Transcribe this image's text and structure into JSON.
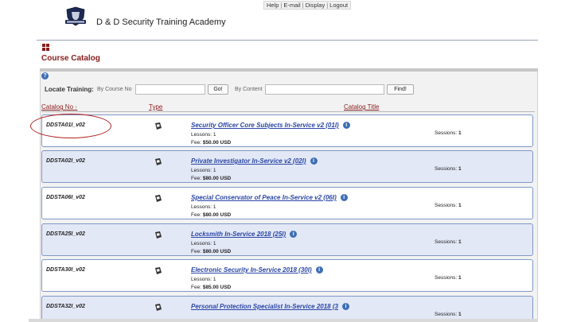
{
  "top_links": [
    "Help",
    "E-mail",
    "Display",
    "Logout"
  ],
  "org_name": "D & D Security Training Academy",
  "page_title": "Course Catalog",
  "locate": {
    "label": "Locate Training:",
    "by_course_no": "By Course No",
    "go_label": "Go!",
    "by_content": "By Content",
    "find_label": "Find!"
  },
  "columns": {
    "catalog_no": "Catalog No",
    "type": "Type",
    "catalog_title": "Catalog Title"
  },
  "sort_indicator": "↑",
  "courses": [
    {
      "catalog_no": "DDSTA01I_v02",
      "title": "Security Officer Core Subjects In-Service v2 (01I)",
      "lessons": "Lessons: 1",
      "fee_label": "Fee:",
      "fee": "$50.00 USD",
      "sessions_label": "Sessions:",
      "sessions": "1"
    },
    {
      "catalog_no": "DDSTA02I_v02",
      "title": "Private Investigator In-Service v2 (02I)",
      "lessons": "Lessons: 1",
      "fee_label": "Fee:",
      "fee": "$80.00 USD",
      "sessions_label": "Sessions:",
      "sessions": "1"
    },
    {
      "catalog_no": "DDSTA06I_v02",
      "title": "Special Conservator of Peace In-Service v2 (06I)",
      "lessons": "Lessons: 1",
      "fee_label": "Fee:",
      "fee": "$80.00 USD",
      "sessions_label": "Sessions:",
      "sessions": "1"
    },
    {
      "catalog_no": "DDSTA25I_v02",
      "title": "Locksmith In-Service 2018 (25I)",
      "lessons": "Lessons: 1",
      "fee_label": "Fee:",
      "fee": "$80.00 USD",
      "sessions_label": "Sessions:",
      "sessions": "1"
    },
    {
      "catalog_no": "DDSTA30I_v02",
      "title": "Electronic Security In-Service 2018 (30I)",
      "lessons": "Lessons: 1",
      "fee_label": "Fee:",
      "fee": "$85.00 USD",
      "sessions_label": "Sessions:",
      "sessions": "1"
    },
    {
      "catalog_no": "DDSTA32I_v02",
      "title": "Personal Protection Specialist In-Service 2018 (3",
      "lessons": "",
      "fee_label": "",
      "fee": "",
      "sessions_label": "Sessions:",
      "sessions": "1"
    }
  ],
  "colors": {
    "title_red": "#8a1c1c",
    "link_blue": "#2a46a6",
    "row_alt": "#e3e8f6",
    "row_border": "#7e98c8",
    "annotation_red": "#b02020"
  },
  "icons": {
    "logo": "academy-badge-icon",
    "menu": "grid-menu-icon",
    "help": "help-circle-icon",
    "type": "online-course-icon",
    "info": "info-icon"
  }
}
